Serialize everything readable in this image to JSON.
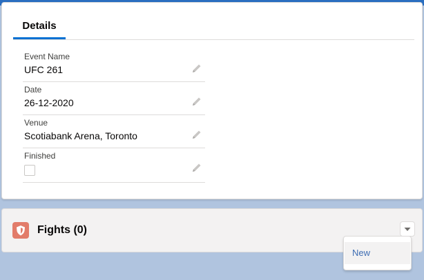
{
  "details_tab": {
    "label": "Details"
  },
  "fields": [
    {
      "label": "Event Name",
      "value": "UFC 261"
    },
    {
      "label": "Date",
      "value": "26-12-2020"
    },
    {
      "label": "Venue",
      "value": "Scotiabank Arena, Toronto"
    },
    {
      "label": "Finished",
      "checked": false
    }
  ],
  "related_list": {
    "title": "Fights (0)",
    "icon": "shield-icon",
    "menu_icon": "chevron-down-icon"
  },
  "dropdown": {
    "items": [
      {
        "label": "New"
      }
    ]
  },
  "colors": {
    "accent": "#0070d2",
    "background": "#b0c4df",
    "object_icon": "#e27c6a",
    "link": "#3e6db3"
  }
}
